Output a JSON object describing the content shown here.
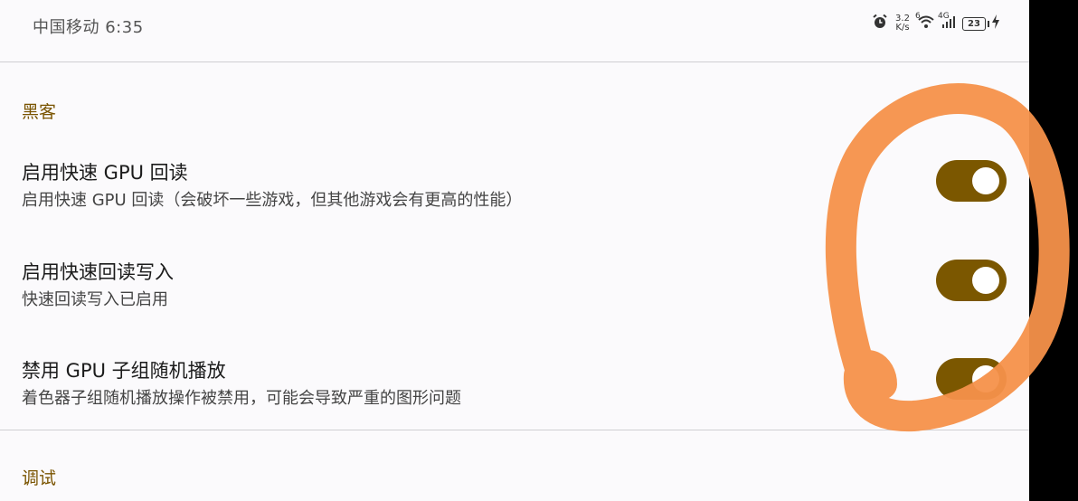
{
  "status_bar": {
    "carrier_time": "中国移动 6:35",
    "net_speed_value": "3.2",
    "net_speed_unit": "K/s",
    "wifi_sub": "6",
    "cell_label": "4G",
    "battery": "23",
    "icons": [
      "alarm-icon",
      "wifi-icon",
      "signal-icon",
      "battery-icon",
      "charging-icon"
    ]
  },
  "sections": [
    {
      "header": "黑客",
      "items": [
        {
          "title": "启用快速 GPU 回读",
          "subtitle": "启用快速 GPU 回读（会破坏一些游戏，但其他游戏会有更高的性能）",
          "enabled": true
        },
        {
          "title": "启用快速回读写入",
          "subtitle": "快速回读写入已启用",
          "enabled": true
        },
        {
          "title": "禁用 GPU 子组随机播放",
          "subtitle": "着色器子组随机播放操作被禁用，可能会导致严重的图形问题",
          "enabled": true
        }
      ]
    },
    {
      "header": "调试",
      "items": []
    }
  ],
  "colors": {
    "accent": "#7b5700",
    "section_header": "#7a5400",
    "annotation": "#f5914a",
    "background": "#fbfafc"
  }
}
